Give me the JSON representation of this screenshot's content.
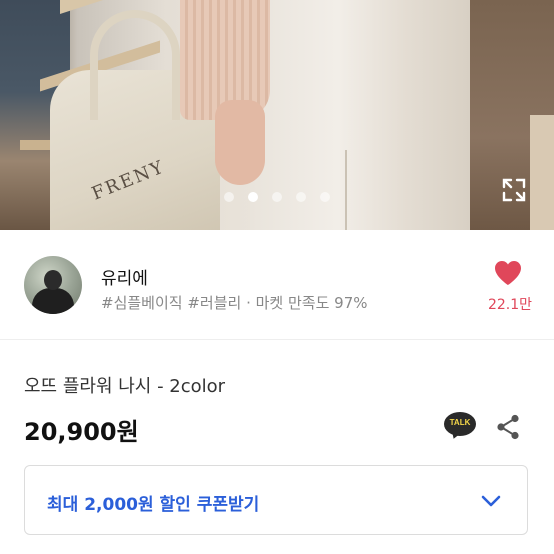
{
  "hero": {
    "bag_text": "FRENY",
    "slides": 5,
    "active_slide": 2,
    "expand_icon": "expand-icon"
  },
  "seller": {
    "name": "유리에",
    "tags": "#심플베이직 #러블리 · 마켓 만족도 97%",
    "like_count": "22.1만",
    "heart_color": "#e0475a"
  },
  "product": {
    "title": "오뜨 플라워 나시 - 2color",
    "price": "20,900원",
    "talk_label": "TALK",
    "share_icon": "share-icon"
  },
  "coupon": {
    "label": "최대 2,000원 할인 쿠폰받기",
    "accent": "#2b5fd9",
    "chevron_icon": "chevron-down-icon"
  }
}
